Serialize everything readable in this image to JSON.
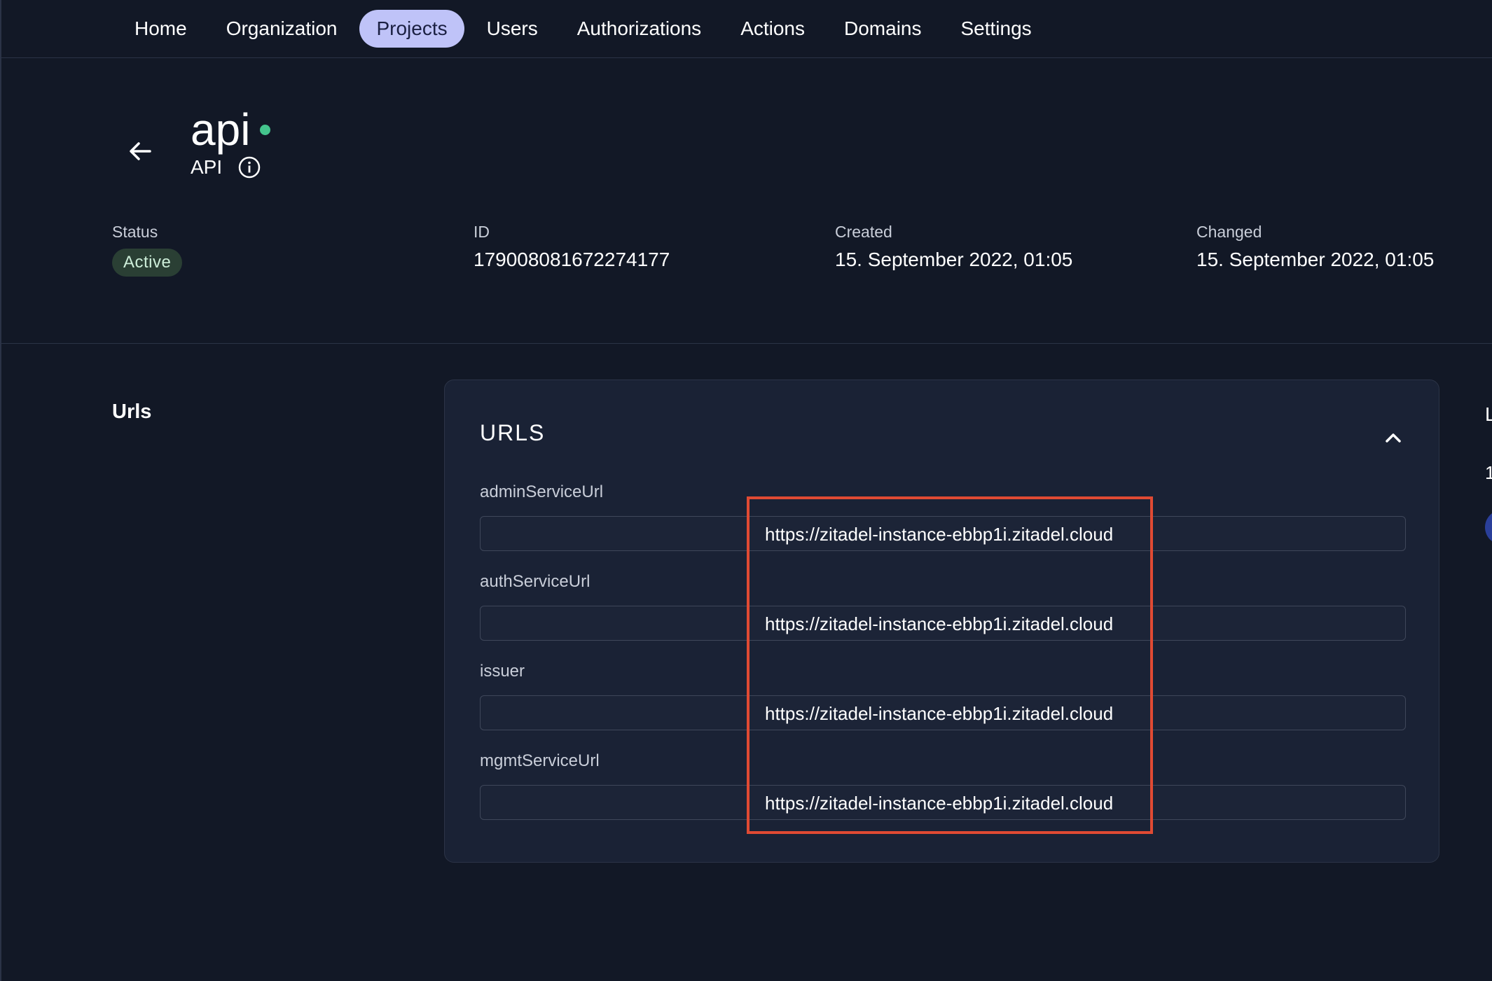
{
  "nav": {
    "items": [
      {
        "label": "Home",
        "active": false
      },
      {
        "label": "Organization",
        "active": false
      },
      {
        "label": "Projects",
        "active": true
      },
      {
        "label": "Users",
        "active": false
      },
      {
        "label": "Authorizations",
        "active": false
      },
      {
        "label": "Actions",
        "active": false
      },
      {
        "label": "Domains",
        "active": false
      },
      {
        "label": "Settings",
        "active": false
      }
    ]
  },
  "header": {
    "title": "api",
    "subtitle": "API",
    "status_color": "#44c48d"
  },
  "meta": {
    "status_label": "Status",
    "status_value": "Active",
    "id_label": "ID",
    "id_value": "179008081672274177",
    "created_label": "Created",
    "created_value": "15. September 2022, 01:05",
    "changed_label": "Changed",
    "changed_value": "15. September 2022, 01:05"
  },
  "section": {
    "label": "Urls"
  },
  "card": {
    "title": "URLS",
    "fields": [
      {
        "label": "adminServiceUrl",
        "value": "https://zitadel-instance-ebbp1i.zitadel.cloud"
      },
      {
        "label": "authServiceUrl",
        "value": "https://zitadel-instance-ebbp1i.zitadel.cloud"
      },
      {
        "label": "issuer",
        "value": "https://zitadel-instance-ebbp1i.zitadel.cloud"
      },
      {
        "label": "mgmtServiceUrl",
        "value": "https://zitadel-instance-ebbp1i.zitadel.cloud"
      }
    ]
  },
  "right_clip": {
    "letter": "L",
    "digit": "1"
  },
  "colors": {
    "background": "#121826",
    "card": "#1a2235",
    "accent_nav": "#bfc3f8",
    "highlight": "#e04a33"
  }
}
